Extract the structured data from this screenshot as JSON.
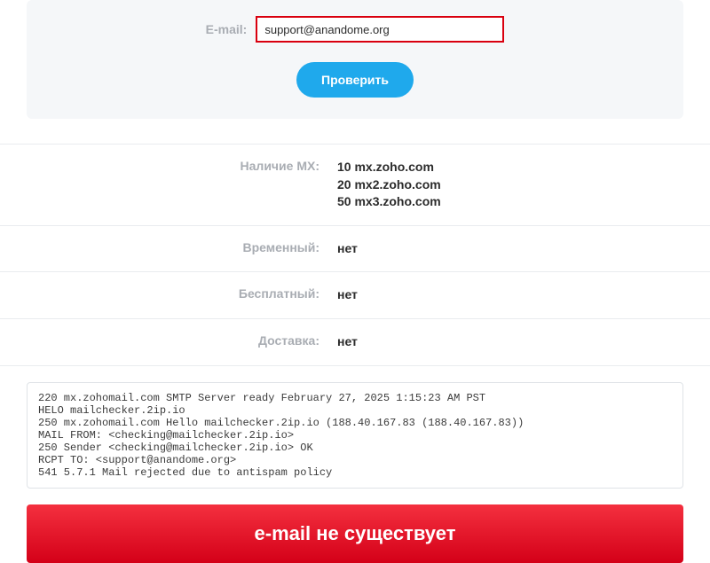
{
  "form": {
    "label": "E-mail:",
    "value": "support@anandome.org",
    "button": "Проверить"
  },
  "results": {
    "mx_label": "Наличие MX:",
    "mx": [
      {
        "priority": "10",
        "host": "mx.zoho.com"
      },
      {
        "priority": "20",
        "host": "mx2.zoho.com"
      },
      {
        "priority": "50",
        "host": "mx3.zoho.com"
      }
    ],
    "temporary_label": "Временный:",
    "temporary_value": "нет",
    "free_label": "Бесплатный:",
    "free_value": "нет",
    "delivery_label": "Доставка:",
    "delivery_value": "нет"
  },
  "log": "220 mx.zohomail.com SMTP Server ready February 27, 2025 1:15:23 AM PST\nHELO mailchecker.2ip.io\n250 mx.zohomail.com Hello mailchecker.2ip.io (188.40.167.83 (188.40.167.83))\nMAIL FROM: <checking@mailchecker.2ip.io>\n250 Sender <checking@mailchecker.2ip.io> OK\nRCPT TO: <support@anandome.org>\n541 5.7.1 Mail rejected due to antispam policy",
  "banner": "e-mail не существует"
}
